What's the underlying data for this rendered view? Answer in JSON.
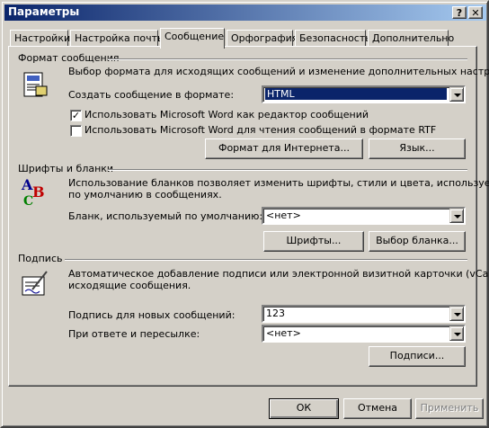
{
  "window": {
    "title": "Параметры",
    "help_glyph": "?",
    "close_glyph": "✕"
  },
  "tabs": [
    {
      "label": "Настройки",
      "active": false
    },
    {
      "label": "Настройка почты",
      "active": false
    },
    {
      "label": "Сообщение",
      "active": true
    },
    {
      "label": "Орфография",
      "active": false
    },
    {
      "label": "Безопасность",
      "active": false
    },
    {
      "label": "Дополнительно",
      "active": false
    }
  ],
  "format_section": {
    "heading": "Формат сообщения",
    "description": "Выбор формата для исходящих сообщений и изменение дополнительных настроек.",
    "compose_label": "Создать сообщение в формате:",
    "compose_value": "HTML",
    "word_editor_label": "Использовать Microsoft Word как редактор сообщений",
    "word_editor_checked": true,
    "word_rtf_label": "Использовать Microsoft Word для чтения сообщений в формате RTF",
    "word_rtf_checked": false,
    "internet_format_button": "Формат для Интернета...",
    "language_button": "Язык..."
  },
  "fonts_section": {
    "heading": "Шрифты и бланки",
    "description_line1": "Использование бланков позволяет изменить шрифты, стили и цвета, используемые",
    "description_line2": "по умолчанию в сообщениях.",
    "stationery_label": "Бланк, используемый по умолчанию:",
    "stationery_value": "<нет>",
    "fonts_button": "Шрифты...",
    "stationery_picker_button": "Выбор бланка..."
  },
  "signature_section": {
    "heading": "Подпись",
    "description_line1": "Автоматическое добавление подписи или электронной визитной карточки (vCard) в",
    "description_line2": "исходящие сообщения.",
    "new_messages_label": "Подпись для новых сообщений:",
    "new_messages_value": "123",
    "reply_label": "При ответе и пересылке:",
    "reply_value": "<нет>",
    "signatures_button": "Подписи..."
  },
  "footer": {
    "ok": "ОК",
    "cancel": "Отмена",
    "apply": "Применить"
  }
}
